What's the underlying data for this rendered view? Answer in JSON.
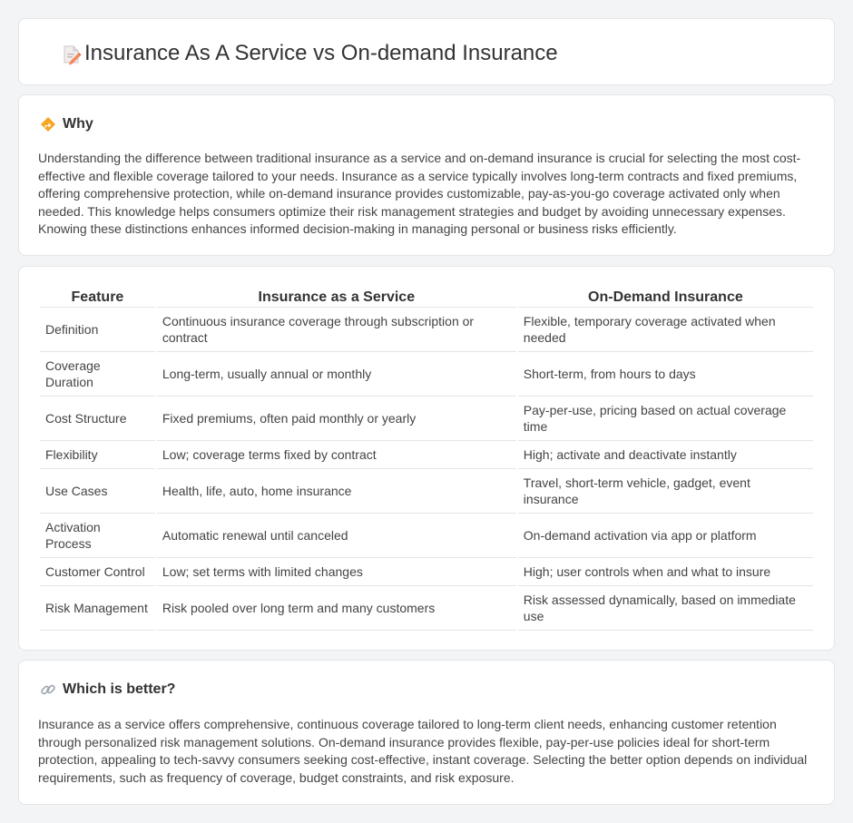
{
  "header": {
    "title": "Insurance As A Service vs On-demand Insurance",
    "icon": "document-pencil-icon"
  },
  "why": {
    "heading": "Why",
    "icon": "diamond-arrow-icon",
    "text": "Understanding the difference between traditional insurance as a service and on-demand insurance is crucial for selecting the most cost-effective and flexible coverage tailored to your needs. Insurance as a service typically involves long-term contracts and fixed premiums, offering comprehensive protection, while on-demand insurance provides customizable, pay-as-you-go coverage activated only when needed. This knowledge helps consumers optimize their risk management strategies and budget by avoiding unnecessary expenses. Knowing these distinctions enhances informed decision-making in managing personal or business risks efficiently."
  },
  "table": {
    "headers": [
      "Feature",
      "Insurance as a Service",
      "On-Demand Insurance"
    ],
    "rows": [
      [
        "Definition",
        "Continuous insurance coverage through subscription or contract",
        "Flexible, temporary coverage activated when needed"
      ],
      [
        "Coverage Duration",
        "Long-term, usually annual or monthly",
        "Short-term, from hours to days"
      ],
      [
        "Cost Structure",
        "Fixed premiums, often paid monthly or yearly",
        "Pay-per-use, pricing based on actual coverage time"
      ],
      [
        "Flexibility",
        "Low; coverage terms fixed by contract",
        "High; activate and deactivate instantly"
      ],
      [
        "Use Cases",
        "Health, life, auto, home insurance",
        "Travel, short-term vehicle, gadget, event insurance"
      ],
      [
        "Activation Process",
        "Automatic renewal until canceled",
        "On-demand activation via app or platform"
      ],
      [
        "Customer Control",
        "Low; set terms with limited changes",
        "High; user controls when and what to insure"
      ],
      [
        "Risk Management",
        "Risk pooled over long term and many customers",
        "Risk assessed dynamically, based on immediate use"
      ]
    ]
  },
  "better": {
    "heading": "Which is better?",
    "icon": "link-icon",
    "text": "Insurance as a service offers comprehensive, continuous coverage tailored to long-term client needs, enhancing customer retention through personalized risk management solutions. On-demand insurance provides flexible, pay-per-use policies ideal for short-term protection, appealing to tech-savvy consumers seeking cost-effective, instant coverage. Selecting the better option depends on individual requirements, such as frequency of coverage, budget constraints, and risk exposure."
  }
}
